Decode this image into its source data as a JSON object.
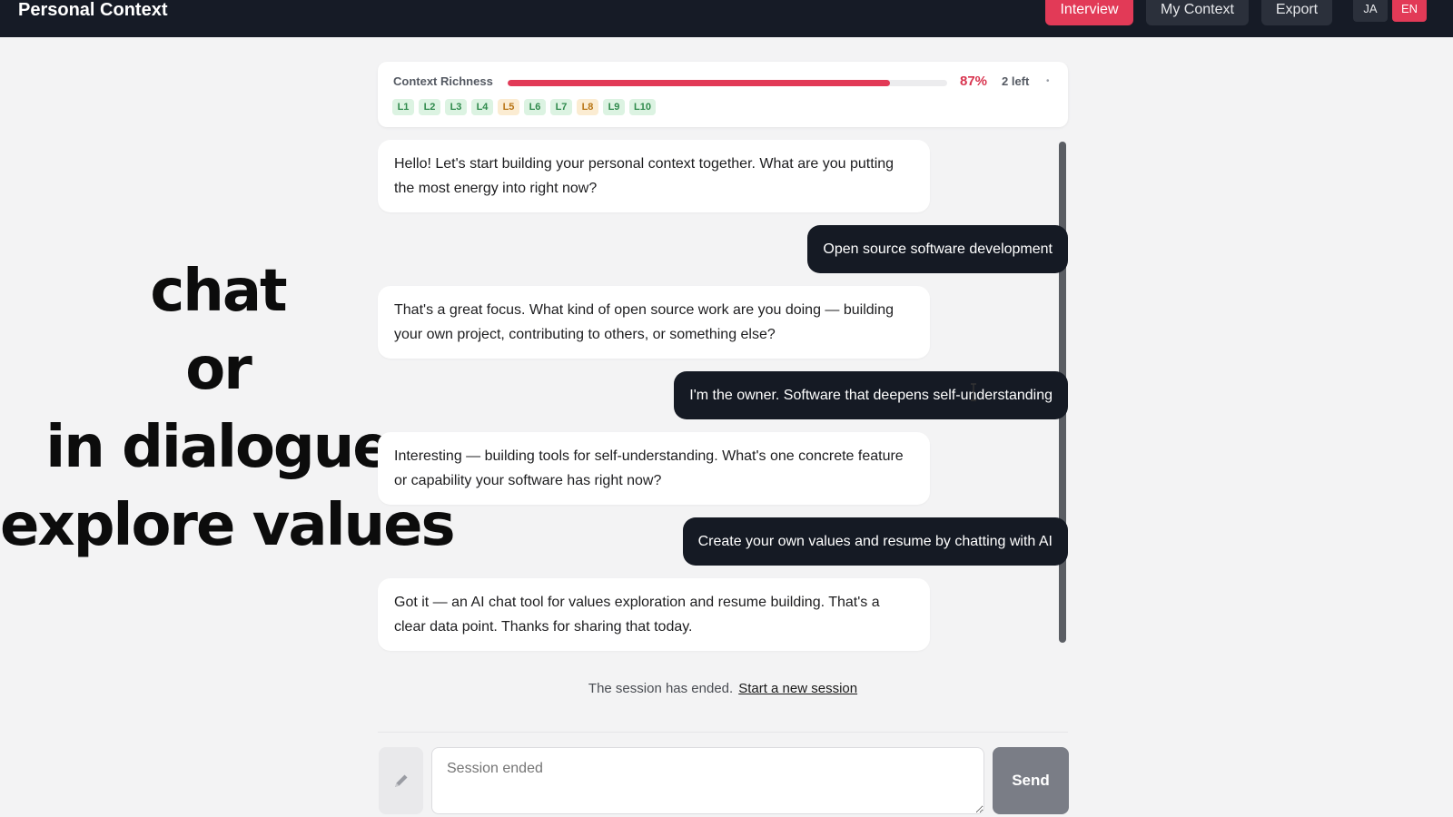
{
  "header": {
    "title": "Personal Context",
    "nav": [
      {
        "label": "Interview",
        "active": true
      },
      {
        "label": "My Context",
        "active": false
      },
      {
        "label": "Export",
        "active": false
      }
    ],
    "languages": [
      {
        "label": "JA",
        "active": false
      },
      {
        "label": "EN",
        "active": true
      }
    ]
  },
  "caption": [
    "chat",
    "or",
    "in dialogue",
    "explore values"
  ],
  "richness": {
    "label": "Context Richness",
    "percent_value": 0.87,
    "percent_text": "87%",
    "remaining": "2 left",
    "levels": [
      {
        "label": "L1",
        "state": "green"
      },
      {
        "label": "L2",
        "state": "green"
      },
      {
        "label": "L3",
        "state": "green"
      },
      {
        "label": "L4",
        "state": "green"
      },
      {
        "label": "L5",
        "state": "amber"
      },
      {
        "label": "L6",
        "state": "green"
      },
      {
        "label": "L7",
        "state": "green"
      },
      {
        "label": "L8",
        "state": "amber"
      },
      {
        "label": "L9",
        "state": "green"
      },
      {
        "label": "L10",
        "state": "green"
      }
    ]
  },
  "messages": [
    {
      "role": "assistant",
      "text": "Hello! Let's start building your personal context together. What are you putting the most energy into right now?"
    },
    {
      "role": "user",
      "text": "Open source software development"
    },
    {
      "role": "assistant",
      "text": "That's a great focus. What kind of open source work are you doing — building your own project, contributing to others, or something else?"
    },
    {
      "role": "user",
      "text": "I'm the owner. Software that deepens self-understanding"
    },
    {
      "role": "assistant",
      "text": "Interesting — building tools for self-understanding. What's one concrete feature or capability your software has right now?"
    },
    {
      "role": "user",
      "text": "Create your own values and resume by chatting with AI"
    },
    {
      "role": "assistant",
      "text": "Got it — an AI chat tool for values exploration and resume building. That's a clear data point. Thanks for sharing that today."
    }
  ],
  "session": {
    "status_text": "The session has ended.",
    "new_session_link": "Start a new session"
  },
  "composer": {
    "placeholder": "Session ended",
    "send_label": "Send",
    "pencil_icon": "pencil-icon"
  },
  "colors": {
    "accent": "#e23a57",
    "topbar": "#161b26",
    "user_bubble": "#151a24"
  }
}
